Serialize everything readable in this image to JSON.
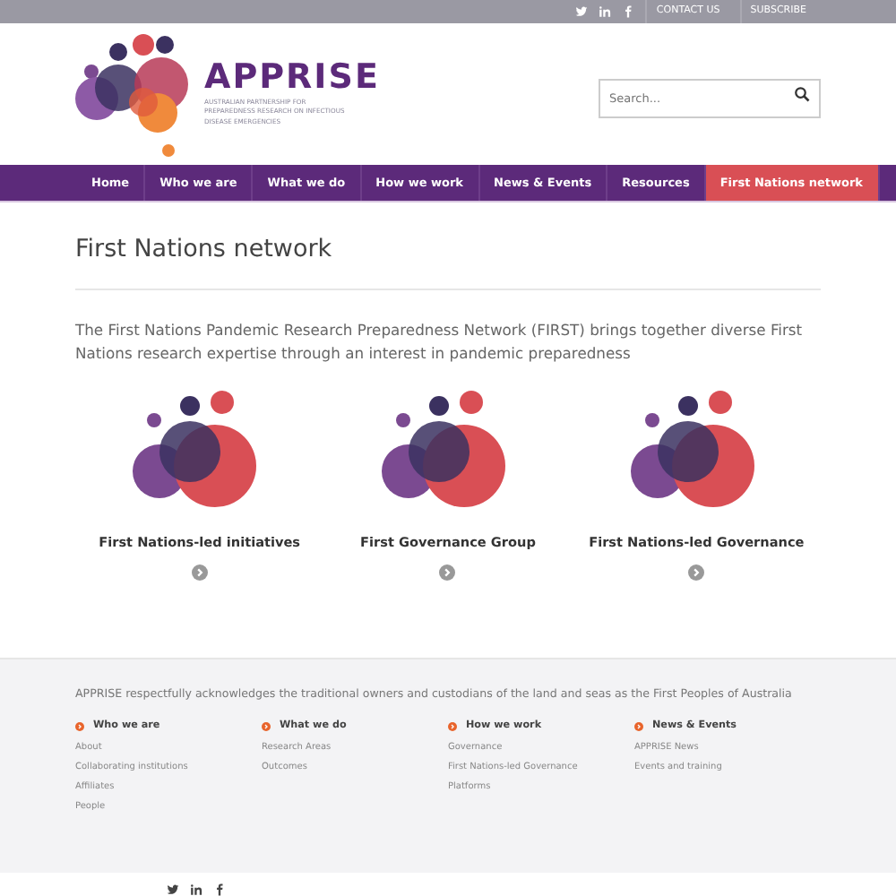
{
  "top_bar": {
    "links": [
      "CONTACT US",
      "SUBSCRIBE"
    ]
  },
  "logo": {
    "name": "APPRISE",
    "tagline": "AUSTRALIAN PARTNERSHIP FOR PREPAREDNESS RESEARCH ON INFECTIOUS DISEASE EMERGENCIES"
  },
  "search": {
    "placeholder": "Search..."
  },
  "nav": [
    {
      "label": "Home",
      "selected": false
    },
    {
      "label": "Who we are",
      "selected": false
    },
    {
      "label": "What we do",
      "selected": false
    },
    {
      "label": "How we work",
      "selected": false
    },
    {
      "label": "News & Events",
      "selected": false
    },
    {
      "label": "Resources",
      "selected": false
    },
    {
      "label": "First Nations network",
      "selected": true
    }
  ],
  "page_title": "First Nations network",
  "intro": "The First Nations Pandemic Research Preparedness Network (FIRST) brings together diverse First Nations research expertise through an interest in pandemic preparedness",
  "cards": [
    {
      "title": "First Nations-led initiatives"
    },
    {
      "title": "First Governance Group"
    },
    {
      "title": "First Nations-led Governance"
    }
  ],
  "footer": {
    "acknowledgement": "APPRISE respectfully acknowledges the traditional owners and custodians of the land and seas as the First Peoples of Australia",
    "columns": [
      {
        "heading": "Who we are",
        "links": [
          "About",
          "Collaborating institutions",
          "Affiliates",
          "People"
        ]
      },
      {
        "heading": "What we do",
        "links": [
          "Research Areas",
          "Outcomes"
        ]
      },
      {
        "heading": "How we work",
        "links": [
          "Governance",
          "First Nations-led Governance",
          "Platforms"
        ]
      },
      {
        "heading": "News & Events",
        "links": [
          "APPRISE News",
          "Events and training"
        ]
      }
    ]
  }
}
